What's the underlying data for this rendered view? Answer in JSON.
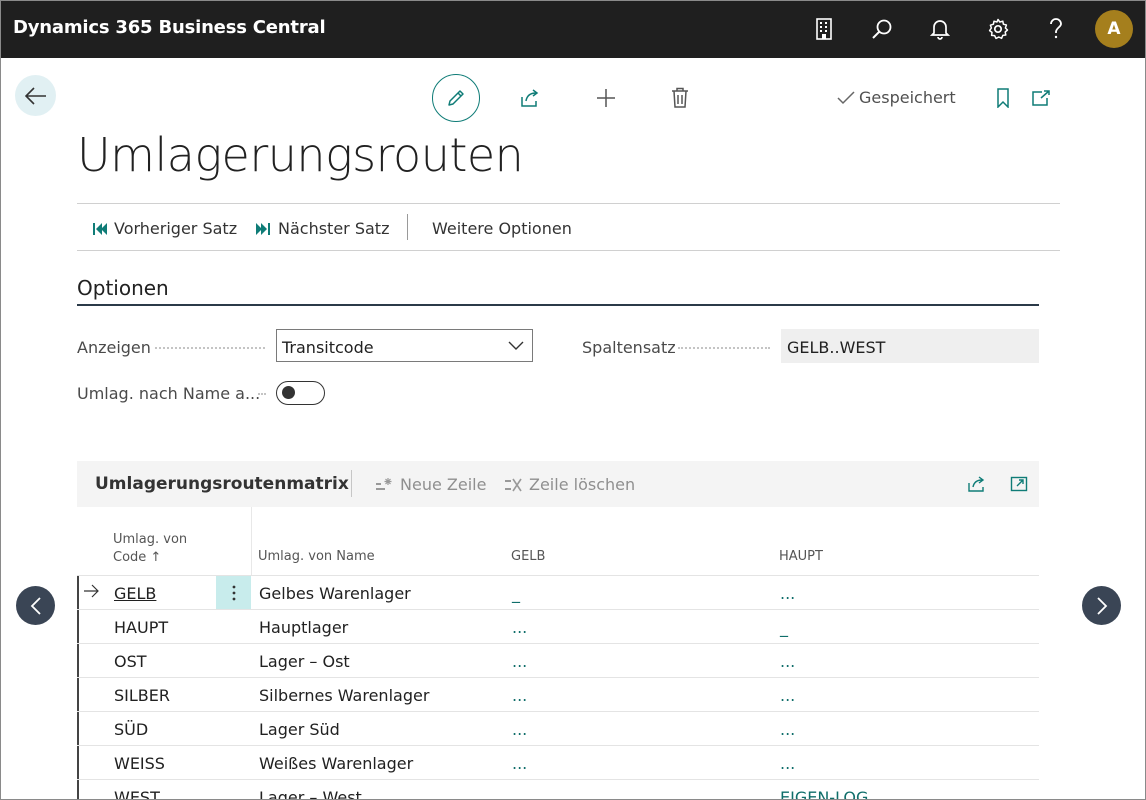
{
  "app": {
    "title": "Dynamics 365 Business Central",
    "user_initial": "A",
    "avatar_color": "#a57f1d",
    "top_icons": [
      "building-icon",
      "search-icon",
      "bell-icon",
      "gear-icon",
      "help-icon"
    ]
  },
  "page": {
    "title": "Umlagerungsrouten",
    "save_status": "Gespeichert",
    "actions": {
      "previous": "Vorheriger Satz",
      "next": "Nächster Satz",
      "more": "Weitere Optionen"
    }
  },
  "options": {
    "section_title": "Optionen",
    "show_label": "Anzeigen",
    "show_value": "Transitcode",
    "column_set_label": "Spaltensatz",
    "column_set_value": "GELB..WEST",
    "toggle_label": "Umlag. nach Name a...",
    "toggle_on": false
  },
  "matrix": {
    "title": "Umlagerungsroutenmatrix",
    "new_row": "Neue Zeile",
    "delete_row": "Zeile löschen",
    "columns": {
      "code_line1": "Umlag. von",
      "code_line2": "Code ↑",
      "name": "Umlag. von Name",
      "col1": "GELB",
      "col2": "HAUPT"
    },
    "rows": [
      {
        "code": "GELB",
        "name": "Gelbes Warenlager",
        "gelb": "_",
        "haupt": "..."
      },
      {
        "code": "HAUPT",
        "name": "Hauptlager",
        "gelb": "...",
        "haupt": "_"
      },
      {
        "code": "OST",
        "name": "Lager – Ost",
        "gelb": "...",
        "haupt": "..."
      },
      {
        "code": "SILBER",
        "name": "Silbernes Warenlager",
        "gelb": "...",
        "haupt": "..."
      },
      {
        "code": "SÜD",
        "name": "Lager Süd",
        "gelb": "...",
        "haupt": "..."
      },
      {
        "code": "WEISS",
        "name": "Weißes Warenlager",
        "gelb": "...",
        "haupt": "..."
      },
      {
        "code": "WEST",
        "name": "Lager – West",
        "gelb": "",
        "haupt": "EIGEN-LOG"
      }
    ],
    "accent_color": "#0f6e6a"
  }
}
